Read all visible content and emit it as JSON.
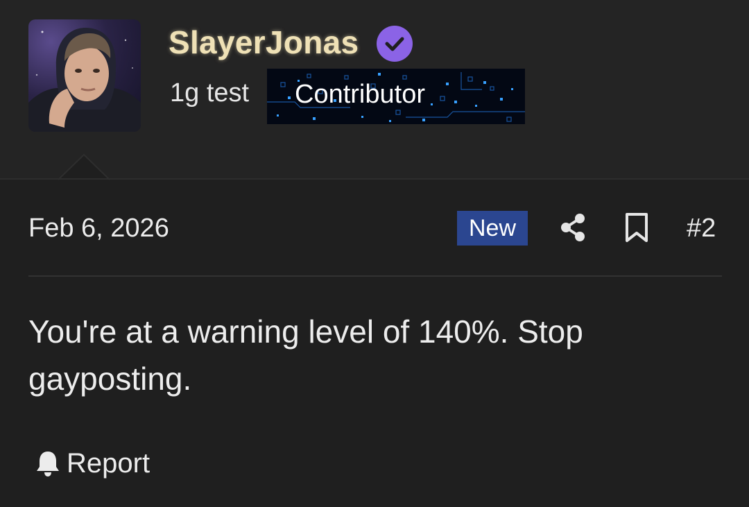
{
  "profile": {
    "username": "SlayerJonas",
    "user_title": "1g test",
    "banner_label": "Contributor",
    "avatar_icon": "user-avatar",
    "verified_icon": "verified-check-icon",
    "username_color": "#efe1b6",
    "verified_color": "#8b63e6"
  },
  "post": {
    "date": "Feb 6, 2026",
    "new_badge": "New",
    "number": "#2",
    "message": "You're at a warning level of 140%. Stop gayposting.",
    "badge_color": "#2b4690"
  },
  "actions": {
    "share_icon": "share-icon",
    "bookmark_icon": "bookmark-icon",
    "report_label": "Report",
    "report_icon": "bell-icon"
  }
}
